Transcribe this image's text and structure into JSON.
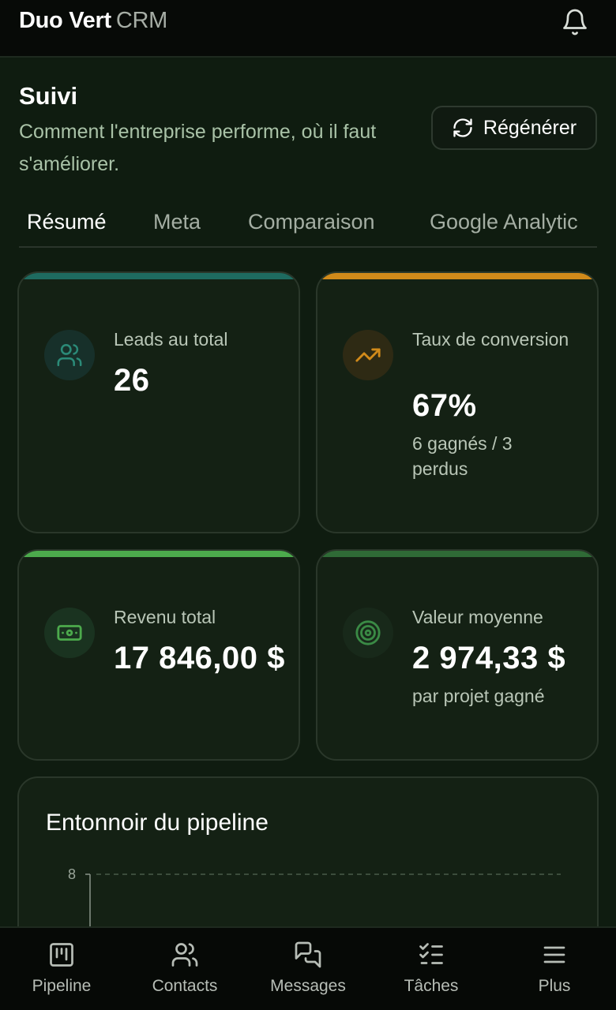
{
  "app": {
    "brand_main": "Duo Vert",
    "brand_suffix": "CRM"
  },
  "header": {
    "title": "Suivi",
    "subtitle": "Comment l'entreprise performe, où il faut s'améliorer.",
    "regenerate_label": "Régénérer"
  },
  "tabs": [
    {
      "label": "Résumé",
      "active": true
    },
    {
      "label": "Meta",
      "active": false
    },
    {
      "label": "Comparaison",
      "active": false
    },
    {
      "label": "Google Analytic",
      "active": false
    }
  ],
  "cards": {
    "leads": {
      "label": "Leads au total",
      "value": "26",
      "accent": "#1e6b60",
      "icon": "users-icon"
    },
    "conversion": {
      "label": "Taux de conversion",
      "value": "67%",
      "sub": "6 gagnés / 3 perdus",
      "accent": "#d18a1a",
      "icon": "trending-up-icon"
    },
    "revenue": {
      "label": "Revenu total",
      "value": "17 846,00 $",
      "accent": "#4caa4c",
      "icon": "banknote-icon"
    },
    "average": {
      "label": "Valeur moyenne",
      "value": "2 974,33 $",
      "sub": "par projet gagné",
      "accent": "#2f6a36",
      "icon": "target-icon"
    }
  },
  "funnel": {
    "title": "Entonnoir du pipeline"
  },
  "chart_data": {
    "type": "bar",
    "title": "Entonnoir du pipeline",
    "y_ticks_visible": [
      "8"
    ],
    "grid": true
  },
  "nav": [
    {
      "label": "Pipeline",
      "icon": "kanban-icon"
    },
    {
      "label": "Contacts",
      "icon": "users-icon"
    },
    {
      "label": "Messages",
      "icon": "messages-icon"
    },
    {
      "label": "Tâches",
      "icon": "checklist-icon"
    },
    {
      "label": "Plus",
      "icon": "menu-icon"
    }
  ],
  "colors": {
    "background": "#0f1c10",
    "card": "#142114",
    "leads_accent": "#1e6b60",
    "conversion_accent": "#d18a1a",
    "revenue_accent": "#4caa4c",
    "average_accent": "#2f6a36"
  }
}
